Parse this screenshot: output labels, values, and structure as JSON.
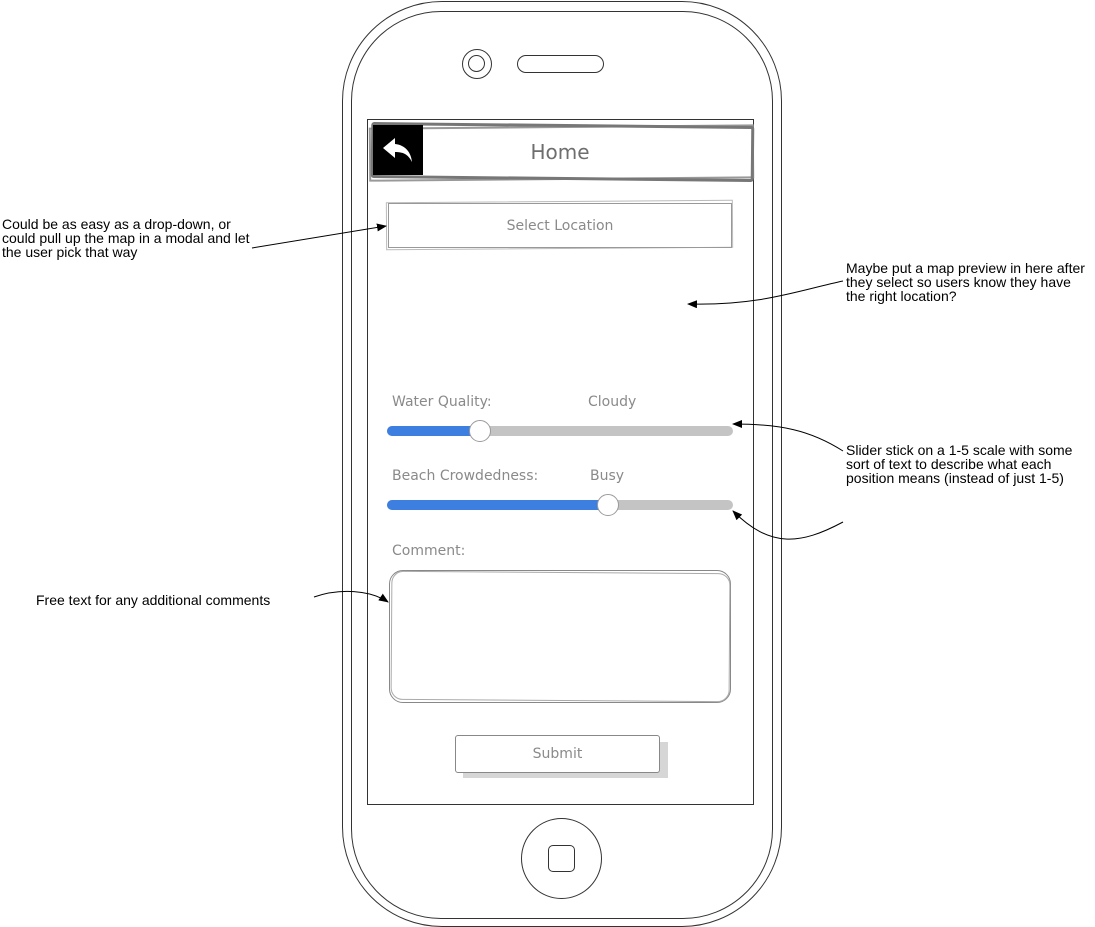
{
  "annotations": {
    "location_note": "Could be as easy as a drop-down, or could pull up the map in a modal and let the user pick that way",
    "map_note": "Maybe put a map preview in here after they select so users know they have the right location?",
    "slider_note": "Slider stick on a 1-5 scale with some sort of text to describe what each position means (instead of just 1-5)",
    "comment_note": "Free text for any additional comments"
  },
  "header": {
    "title": "Home",
    "back_icon": "back-arrow-icon"
  },
  "form": {
    "select_location_label": "Select Location",
    "water_quality": {
      "label": "Water Quality:",
      "value_text": "Cloudy",
      "level_fraction": 0.27
    },
    "beach_crowdedness": {
      "label": "Beach Crowdedness:",
      "value_text": "Busy",
      "level_fraction": 0.64
    },
    "comment_label": "Comment:",
    "comment_value": "",
    "submit_label": "Submit"
  },
  "colors": {
    "slider_fill": "#3d7fe0",
    "slider_track": "#c4c4c4",
    "back_button_bg": "#000000"
  }
}
